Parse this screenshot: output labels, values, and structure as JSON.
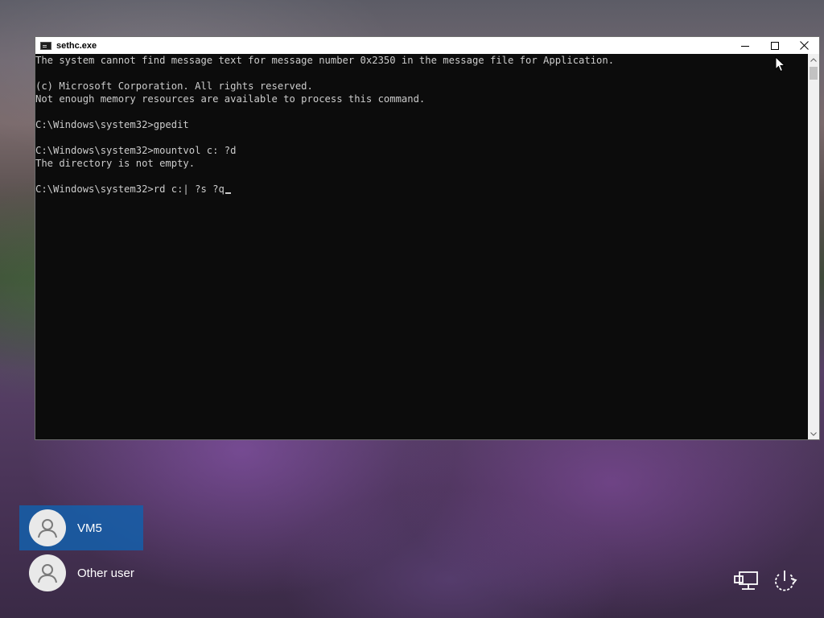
{
  "window": {
    "title": "sethc.exe",
    "controls": [
      "minimize-icon",
      "maximize-icon",
      "close-icon"
    ]
  },
  "console": {
    "lines": [
      "The system cannot find message text for message number 0x2350 in the message file for Application.",
      "",
      "(c) Microsoft Corporation. All rights reserved.",
      "Not enough memory resources are available to process this command.",
      "",
      "C:\\Windows\\system32>gpedit",
      "",
      "C:\\Windows\\system32>mountvol c: ?d",
      "The directory is not empty.",
      "",
      "C:\\Windows\\system32>rd c:| ?s ?q"
    ],
    "text_color": "#cccccc",
    "background": "#0c0c0c"
  },
  "users": [
    {
      "name": "VM5",
      "selected": true
    },
    {
      "name": "Other user",
      "selected": false
    }
  ],
  "system_tray": [
    "network-icon",
    "power-icon"
  ],
  "accent_color": "#145faa"
}
